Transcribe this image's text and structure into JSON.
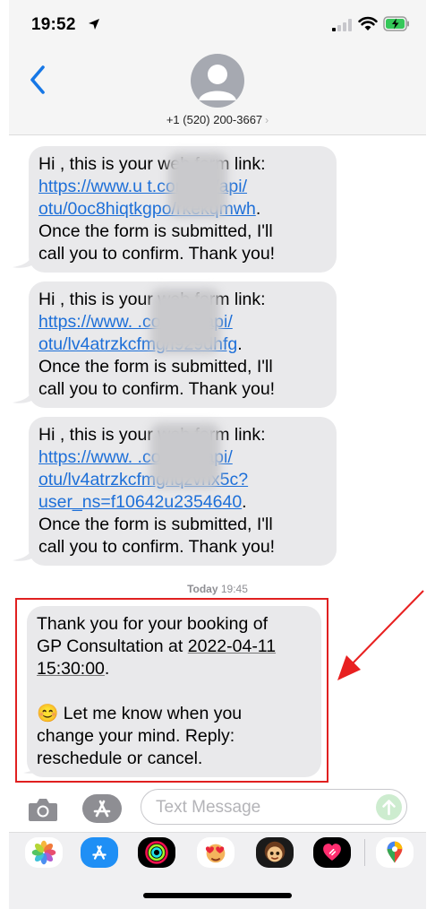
{
  "status_bar": {
    "time": "19:52"
  },
  "header": {
    "contact": "+1 (520) 200-3667",
    "chevron": "›"
  },
  "messages": [
    {
      "line1": "Hi , this is your web form link:",
      "link1": "https://www.u      t.com.au/api/",
      "link2": "otu/0oc8hiqtkgpo/rkekqmwh",
      "link2_end": ".",
      "line4": "Once the form is submitted, I'll",
      "line5": "call you to confirm. Thank you!"
    },
    {
      "line1": "Hi , this is your web form link:",
      "link1": "https://www.      .com.au/api/",
      "link2": "otu/lv4atrzkcfmg/l929dhfg",
      "link2_end": ".",
      "line4": "Once the form is submitted, I'll",
      "line5": "call you to confirm. Thank you!"
    },
    {
      "line1": "Hi , this is your web form link:",
      "link1": "https://www.      .com.au/api/",
      "link2": "otu/lv4atrzkcfmg/iqzvnx5c?",
      "link3": "user_ns=f10642u2354640",
      "link3_end": ".",
      "line4": "Once the form is submitted, I'll",
      "line5": "call you to confirm. Thank you!"
    }
  ],
  "timestamp": {
    "day": "Today",
    "time": "19:45"
  },
  "last_message": {
    "line1": "Thank you for your booking of",
    "line2_prefix": "GP Consultation at ",
    "date": "2022-04-11",
    "time": "15:30:00",
    "time_end": ".",
    "emoji": "😊",
    "line4": " Let me know when you",
    "line5": "change your mind. Reply:",
    "line6": "reschedule or cancel."
  },
  "input": {
    "placeholder": "Text Message"
  },
  "app_drawer": [
    "photos-app",
    "app-store",
    "fitness-activity",
    "memoji-stickers",
    "animoji",
    "digital-touch",
    "google-maps"
  ]
}
